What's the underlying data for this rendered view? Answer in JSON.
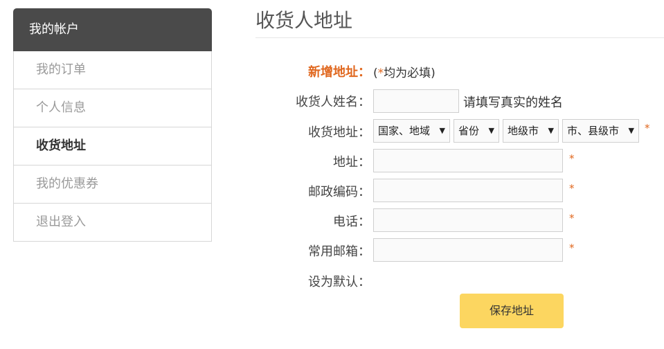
{
  "sidebar": {
    "header": "我的帐户",
    "items": [
      {
        "label": "我的订单"
      },
      {
        "label": "个人信息"
      },
      {
        "label": "收货地址"
      },
      {
        "label": "我的优惠券"
      },
      {
        "label": "退出登入"
      }
    ],
    "active_index": 2
  },
  "main": {
    "title": "收货人地址",
    "form": {
      "new_address_label": "新增地址：",
      "required_note_prefix": "(",
      "required_note_star": "*",
      "required_note_suffix": "均为必填)",
      "name_label": "收货人姓名：",
      "name_value": "",
      "name_hint": "请填写真实的姓名",
      "region_label": "收货地址：",
      "country_select": "国家、地域",
      "province_select": "省份",
      "city_select": "地级市",
      "county_select": "市、县级市",
      "address_label": "地址：",
      "postcode_label": "邮政编码：",
      "phone_label": "电话：",
      "email_label": "常用邮箱：",
      "default_label": "设为默认：",
      "required_star": "*",
      "save_label": "保存地址"
    }
  },
  "colors": {
    "accent": "#e0671e",
    "button": "#fcd660",
    "sidebar_header": "#4a4a4a"
  }
}
